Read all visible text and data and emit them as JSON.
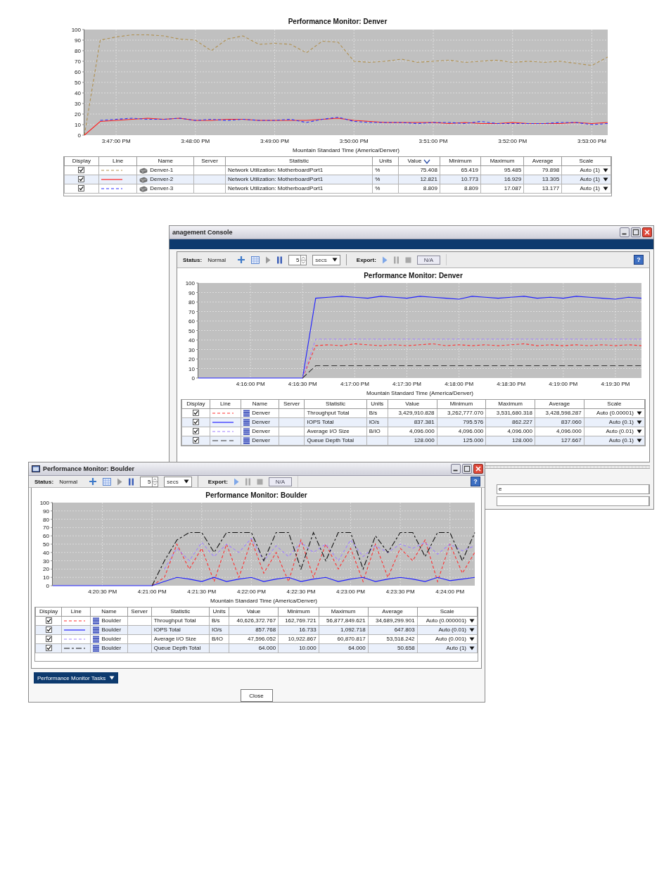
{
  "report_chart": {
    "chart_data": {
      "type": "line",
      "title": "Performance Monitor: Denver",
      "xlabel": "Mountain Standard Time (America/Denver)",
      "categories": [
        null,
        null,
        "3:47:00 PM",
        null,
        null,
        null,
        null,
        "3:48:00 PM",
        null,
        null,
        null,
        null,
        "3:49:00 PM",
        null,
        null,
        null,
        null,
        "3:50:00 PM",
        null,
        null,
        null,
        null,
        "3:51:00 PM",
        null,
        null,
        null,
        null,
        "3:52:00 PM",
        null,
        null,
        null,
        null,
        "3:53:00 PM",
        null
      ],
      "series": [
        {
          "color": "#b0904f",
          "line_style": "dashed",
          "values": [
            0,
            90,
            93,
            95,
            95,
            94,
            91,
            90,
            80,
            91,
            94,
            86,
            87,
            86,
            78,
            89,
            88,
            70,
            69,
            70,
            72,
            69,
            70,
            71,
            69,
            70,
            71,
            69,
            70,
            69,
            70,
            68,
            66,
            74
          ]
        },
        {
          "color": "#ff2020",
          "line_style": "solid",
          "values": [
            0,
            13,
            14,
            15,
            16,
            15,
            16,
            14,
            14,
            15,
            15,
            14,
            14,
            14,
            14,
            15,
            16,
            14,
            13,
            12,
            12,
            12,
            12,
            11,
            12,
            11,
            11,
            12,
            11,
            11,
            11,
            12,
            11,
            12
          ]
        },
        {
          "color": "#2e2eff",
          "line_style": "dashed",
          "values": [
            null,
            14,
            15,
            16,
            15,
            15,
            16,
            14,
            15,
            14,
            15,
            14,
            14,
            15,
            12,
            15,
            17,
            13,
            12,
            12,
            12,
            11,
            12,
            12,
            11,
            13,
            11,
            11,
            11,
            11,
            12,
            12,
            10,
            11
          ]
        }
      ],
      "ylim": [
        0,
        100
      ],
      "yticks": [
        0,
        10,
        20,
        30,
        40,
        50,
        60,
        70,
        80,
        90,
        100
      ],
      "grid": true
    },
    "table": {
      "kind": "server",
      "columns": [
        {
          "label": "Display",
          "sorted": false
        },
        {
          "label": "Line",
          "sorted": false
        },
        {
          "label": "Name",
          "sorted": false
        },
        {
          "label": "Server",
          "sorted": false
        },
        {
          "label": "Statistic",
          "sorted": false
        },
        {
          "label": "Units",
          "sorted": false
        },
        {
          "label": "Value",
          "sorted": true
        },
        {
          "label": "Minimum",
          "sorted": false
        },
        {
          "label": "Maximum",
          "sorted": false
        },
        {
          "label": "Average",
          "sorted": false
        },
        {
          "label": "Scale",
          "sorted": false
        }
      ],
      "rows": [
        {
          "checked": true,
          "name": "Denver-1",
          "statistic": "Network Utilization: MotherboardPort1",
          "units": "%",
          "value": "75.408",
          "minimum": "65.419",
          "maximum": "95.485",
          "average": "79.898",
          "scale": "Auto (1)"
        },
        {
          "checked": true,
          "name": "Denver-2",
          "statistic": "Network Utilization: MotherboardPort1",
          "units": "%",
          "value": "12.821",
          "minimum": "10.773",
          "maximum": "16.929",
          "average": "13.305",
          "scale": "Auto (1)"
        },
        {
          "checked": true,
          "name": "Denver-3",
          "statistic": "Network Utilization: MotherboardPort1",
          "units": "%",
          "value": "8.809",
          "minimum": "8.809",
          "maximum": "17.087",
          "average": "13.177",
          "scale": "Auto (1)"
        }
      ]
    }
  },
  "console_window": {
    "title": "anagement Console",
    "toolbar": {
      "status_label": "Status:",
      "status": "Normal",
      "interval": "5",
      "unit": "secs",
      "export_label": "Export:",
      "export_target": "N/A",
      "help": "?"
    },
    "monitor": {
      "chart_data": {
        "type": "line",
        "title": "Performance Monitor: Denver",
        "xlabel": "Mountain Standard Time (America/Denver)",
        "categories": [
          null,
          null,
          null,
          null,
          "4:16:00 PM",
          null,
          null,
          null,
          "4:16:30 PM",
          null,
          null,
          null,
          "4:17:00 PM",
          null,
          null,
          null,
          "4:17:30 PM",
          null,
          null,
          null,
          "4:18:00 PM",
          null,
          null,
          null,
          "4:18:30 PM",
          null,
          null,
          null,
          "4:19:00 PM",
          null,
          null,
          null,
          "4:19:30 PM",
          null,
          null
        ],
        "series": [
          {
            "color": "#ff3030",
            "line_style": "dashed",
            "values": [
              null,
              null,
              null,
              null,
              null,
              null,
              null,
              null,
              0,
              34,
              35,
              34,
              36,
              35,
              34,
              35,
              34,
              35,
              36,
              34,
              35,
              34,
              35,
              34,
              35,
              36,
              34,
              35,
              34,
              35,
              34,
              35,
              34,
              35,
              34
            ]
          },
          {
            "color": "#2020ff",
            "line_style": "solid",
            "values": [
              0,
              0,
              0,
              0,
              0,
              0,
              0,
              0,
              0,
              84,
              85,
              86,
              85,
              84,
              86,
              85,
              84,
              86,
              85,
              84,
              83,
              86,
              85,
              84,
              85,
              86,
              84,
              85,
              84,
              86,
              85,
              84,
              83,
              85,
              84
            ]
          },
          {
            "color": "#a080ff",
            "line_style": "dashed",
            "values": [
              null,
              null,
              null,
              null,
              null,
              null,
              null,
              null,
              0,
              41,
              41,
              41,
              41,
              41,
              41,
              41,
              41,
              41,
              41,
              41,
              41,
              41,
              41,
              41,
              41,
              41,
              41,
              41,
              41,
              41,
              41,
              41,
              41,
              41,
              41
            ]
          },
          {
            "color": "#333333",
            "line_style": "longdash",
            "values": [
              null,
              null,
              null,
              null,
              null,
              null,
              null,
              null,
              0,
              13,
              13,
              13,
              13,
              13,
              13,
              13,
              13,
              13,
              13,
              13,
              13,
              13,
              13,
              13,
              13,
              13,
              13,
              13,
              13,
              13,
              13,
              13,
              13,
              13,
              13
            ]
          }
        ],
        "ylim": [
          0,
          100
        ],
        "yticks": [
          0,
          10,
          20,
          30,
          40,
          50,
          60,
          70,
          80,
          90,
          100
        ],
        "grid": true
      },
      "table": {
        "kind": "storage",
        "columns": [
          {
            "label": "Display",
            "sorted": false
          },
          {
            "label": "Line",
            "sorted": false
          },
          {
            "label": "Name",
            "sorted": false
          },
          {
            "label": "Server",
            "sorted": false
          },
          {
            "label": "Statistic",
            "sorted": false
          },
          {
            "label": "Units",
            "sorted": false
          },
          {
            "label": "Value",
            "sorted": false
          },
          {
            "label": "Minimum",
            "sorted": false
          },
          {
            "label": "Maximum",
            "sorted": false
          },
          {
            "label": "Average",
            "sorted": false
          },
          {
            "label": "Scale",
            "sorted": false
          }
        ],
        "rows": [
          {
            "checked": true,
            "name": "Denver",
            "statistic": "Throughput Total",
            "units": "B/s",
            "value": "3,429,910.828",
            "minimum": "3,262,777.070",
            "maximum": "3,531,680.318",
            "average": "3,428,598.287",
            "scale": "Auto (0.00001)"
          },
          {
            "checked": true,
            "name": "Denver",
            "statistic": "IOPS Total",
            "units": "IO/s",
            "value": "837.381",
            "minimum": "795.576",
            "maximum": "862.227",
            "average": "837.060",
            "scale": "Auto (0.1)"
          },
          {
            "checked": true,
            "name": "Denver",
            "statistic": "Average I/O Size",
            "units": "B/IO",
            "value": "4,096.000",
            "minimum": "4,096.000",
            "maximum": "4,096.000",
            "average": "4,096.000",
            "scale": "Auto (0.01)"
          },
          {
            "checked": true,
            "name": "Denver",
            "statistic": "Queue Depth Total",
            "value": "128.000",
            "minimum": "125.000",
            "maximum": "128.000",
            "average": "127.667",
            "scale": "Auto (0.1)"
          }
        ]
      }
    },
    "field_text": "e"
  },
  "boulder_window": {
    "title": "Performance Monitor: Boulder",
    "toolbar": {
      "status_label": "Status:",
      "status": "Normal",
      "interval": "5",
      "unit": "secs",
      "export_label": "Export:",
      "export_target": "N/A",
      "help": "?"
    },
    "monitor": {
      "chart_data": {
        "type": "line",
        "title": "Performance Monitor: Boulder",
        "xlabel": "Mountain Standard Time (America/Denver)",
        "categories": [
          null,
          null,
          null,
          null,
          "4:20:30 PM",
          null,
          null,
          null,
          "4:21:00 PM",
          null,
          null,
          null,
          "4:21:30 PM",
          null,
          null,
          null,
          "4:22:00 PM",
          null,
          null,
          null,
          "4:22:30 PM",
          null,
          null,
          null,
          "4:23:00 PM",
          null,
          null,
          null,
          "4:23:30 PM",
          null,
          null,
          null,
          "4:24:00 PM",
          null,
          null
        ],
        "series": [
          {
            "color": "#ff3030",
            "line_style": "dashed",
            "values": [
              null,
              null,
              null,
              null,
              null,
              null,
              null,
              null,
              0,
              10,
              50,
              20,
              45,
              5,
              50,
              10,
              55,
              15,
              40,
              5,
              55,
              10,
              50,
              20,
              45,
              5,
              50,
              10,
              45,
              30,
              55,
              5,
              50,
              15,
              40
            ]
          },
          {
            "color": "#2020ff",
            "line_style": "solid",
            "values": [
              0,
              0,
              0,
              0,
              0,
              0,
              0,
              0,
              0,
              5,
              10,
              8,
              5,
              10,
              5,
              8,
              10,
              5,
              8,
              10,
              5,
              8,
              10,
              5,
              8,
              10,
              5,
              8,
              10,
              8,
              5,
              10,
              6,
              8,
              10
            ]
          },
          {
            "color": "#a080ff",
            "line_style": "dashed",
            "values": [
              null,
              null,
              null,
              null,
              null,
              null,
              null,
              null,
              null,
              20,
              45,
              30,
              52,
              35,
              50,
              40,
              57,
              30,
              48,
              35,
              52,
              40,
              50,
              30,
              55,
              35,
              48,
              40,
              50,
              45,
              52,
              38,
              50,
              42,
              48
            ]
          },
          {
            "color": "#111111",
            "line_style": "longshort",
            "values": [
              null,
              null,
              null,
              null,
              null,
              null,
              null,
              null,
              0,
              30,
              55,
              64,
              64,
              40,
              64,
              64,
              64,
              30,
              64,
              64,
              20,
              64,
              30,
              64,
              64,
              20,
              60,
              40,
              64,
              64,
              35,
              64,
              64,
              30,
              64
            ]
          }
        ],
        "ylim": [
          0,
          100
        ],
        "yticks": [
          0,
          10,
          20,
          30,
          40,
          50,
          60,
          70,
          80,
          90,
          100
        ],
        "grid": true
      },
      "table": {
        "kind": "storage",
        "columns": [
          {
            "label": "Display",
            "sorted": false
          },
          {
            "label": "Line",
            "sorted": false
          },
          {
            "label": "Name",
            "sorted": false
          },
          {
            "label": "Server",
            "sorted": false
          },
          {
            "label": "Statistic",
            "sorted": false
          },
          {
            "label": "Units",
            "sorted": false
          },
          {
            "label": "Value",
            "sorted": false
          },
          {
            "label": "Minimum",
            "sorted": false
          },
          {
            "label": "Maximum",
            "sorted": false
          },
          {
            "label": "Average",
            "sorted": false
          },
          {
            "label": "Scale",
            "sorted": false
          }
        ],
        "rows": [
          {
            "checked": true,
            "name": "Boulder",
            "statistic": "Throughput Total",
            "units": "B/s",
            "value": "40,626,372.767",
            "minimum": "162,769.721",
            "maximum": "56,877,849.621",
            "average": "34,689,299.901",
            "scale": "Auto (0.000001)"
          },
          {
            "checked": true,
            "name": "Boulder",
            "statistic": "IOPS Total",
            "units": "IO/s",
            "value": "857.768",
            "minimum": "16.733",
            "maximum": "1,092.718",
            "average": "647.803",
            "scale": "Auto (0.01)"
          },
          {
            "checked": true,
            "name": "Boulder",
            "statistic": "Average I/O Size",
            "units": "B/IO",
            "value": "47,596.052",
            "minimum": "10,922.867",
            "maximum": "60,870.817",
            "average": "53,518.242",
            "scale": "Auto (0.001)"
          },
          {
            "checked": true,
            "name": "Boulder",
            "statistic": "Queue Depth Total",
            "value": "64.000",
            "minimum": "10.000",
            "maximum": "64.000",
            "average": "50.658",
            "scale": "Auto (1)"
          }
        ]
      }
    },
    "tasks_button": "Performance Monitor Tasks",
    "close_button": "Close"
  }
}
